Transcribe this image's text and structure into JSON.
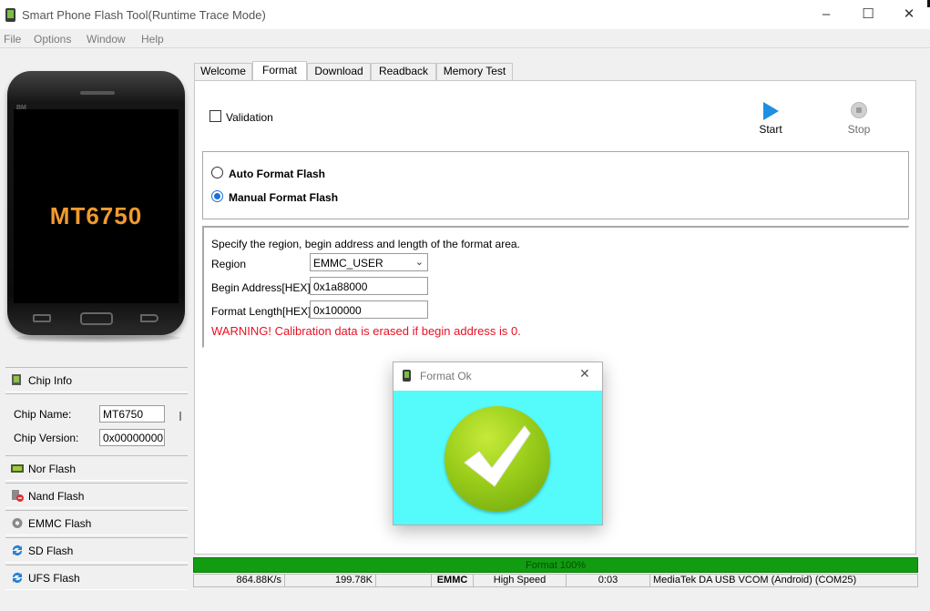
{
  "window": {
    "title": "Smart Phone Flash Tool(Runtime Trace Mode)",
    "min_glyph": "–",
    "max_glyph": "☐",
    "close_glyph": "✕"
  },
  "menu": [
    "File",
    "Options",
    "Window",
    "Help"
  ],
  "phone": {
    "chip": "MT6750",
    "brand": "BM"
  },
  "left_panel": {
    "chip_info": {
      "label": "Chip Info",
      "name_label": "Chip Name:",
      "name_value": "MT6750",
      "version_label": "Chip Version:",
      "version_value": "0x00000000"
    },
    "items": [
      {
        "label": "Nor Flash",
        "icon": "nor-flash-icon"
      },
      {
        "label": "Nand Flash",
        "icon": "nand-flash-icon"
      },
      {
        "label": "EMMC Flash",
        "icon": "gear-icon"
      },
      {
        "label": "SD Flash",
        "icon": "sync-icon"
      },
      {
        "label": "UFS Flash",
        "icon": "sync-icon"
      }
    ]
  },
  "tabs": [
    {
      "label": "Welcome",
      "active": false
    },
    {
      "label": "Format",
      "active": true
    },
    {
      "label": "Download",
      "active": false
    },
    {
      "label": "Readback",
      "active": false
    },
    {
      "label": "Memory Test",
      "active": false
    }
  ],
  "format": {
    "validation_label": "Validation",
    "validation_checked": false,
    "start_label": "Start",
    "stop_label": "Stop",
    "auto_label": "Auto Format Flash",
    "manual_label": "Manual Format Flash",
    "selected_mode": "manual",
    "description": "Specify the region, begin address and length of the format area.",
    "region_label": "Region",
    "region_value": "EMMC_USER",
    "begin_label": "Begin Address[HEX]:",
    "begin_value": "0x1a88000",
    "length_label": "Format Length[HEX]:",
    "length_value": "0x100000",
    "warning": "WARNING! Calibration data is erased if begin address is 0.",
    "warning_color": "#e81123"
  },
  "dialog": {
    "title": "Format Ok",
    "close_glyph": "✕",
    "body_color": "#55fafa"
  },
  "progress": {
    "text": "Format 100%",
    "percent": 100,
    "color": "#0ea10e"
  },
  "status": {
    "speed": "864.88K/s",
    "size": "199.78K",
    "empty": "",
    "storage": "EMMC",
    "mode": "High Speed",
    "time": "0:03",
    "port": "MediaTek DA USB VCOM (Android) (COM25)"
  }
}
